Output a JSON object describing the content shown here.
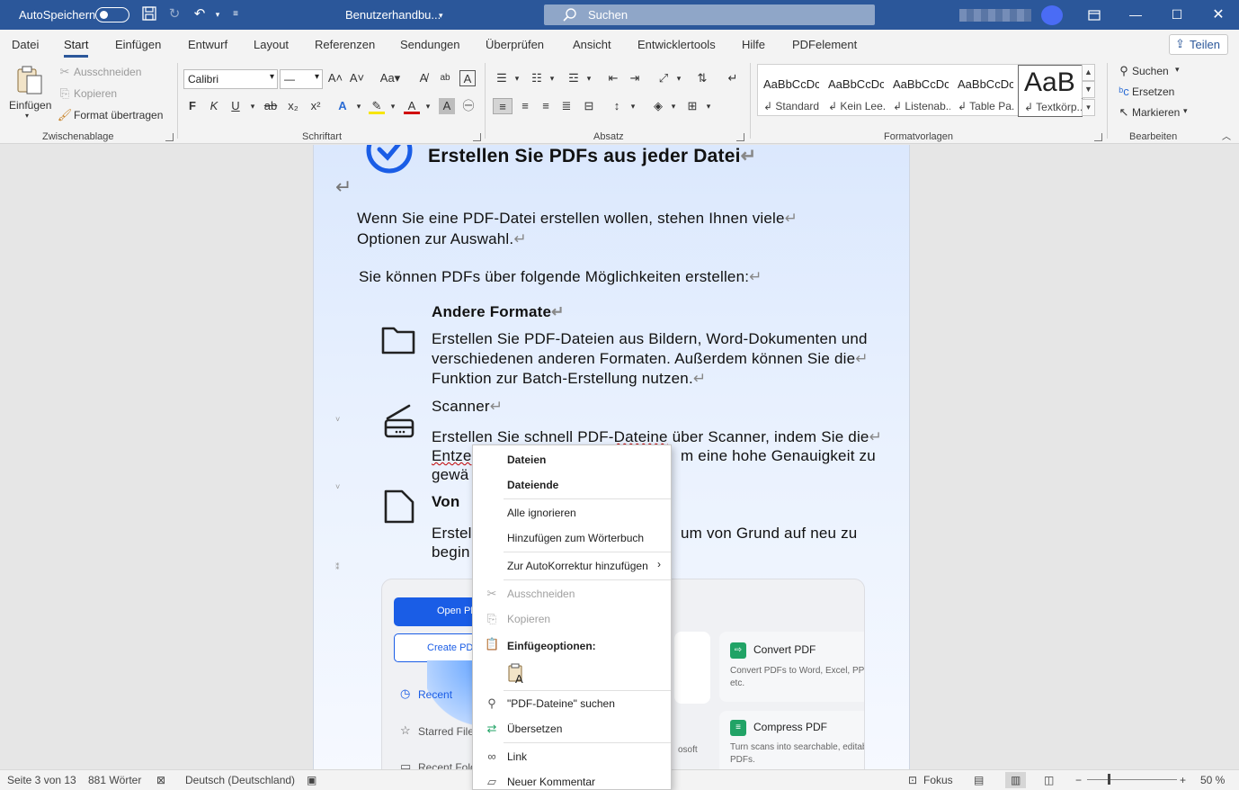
{
  "titlebar": {
    "autosave_label": "AutoSpeichern",
    "doc_title": "Benutzerhandbu...",
    "search_placeholder": "Suchen"
  },
  "menu": {
    "tabs": [
      "Datei",
      "Start",
      "Einfügen",
      "Entwurf",
      "Layout",
      "Referenzen",
      "Sendungen",
      "Überprüfen",
      "Ansicht",
      "Entwicklertools",
      "Hilfe",
      "PDFelement"
    ],
    "active_tab": "Start",
    "share_label": "Teilen"
  },
  "ribbon": {
    "clipboard": {
      "paste": "Einfügen",
      "cut": "Ausschneiden",
      "copy": "Kopieren",
      "format_painter": "Format übertragen",
      "group": "Zwischenablage"
    },
    "font": {
      "family": "Calibri",
      "group": "Schriftart"
    },
    "paragraph": {
      "group": "Absatz"
    },
    "styles": {
      "items": [
        {
          "preview": "AaBbCcDc",
          "name": "↲ Standard"
        },
        {
          "preview": "AaBbCcDc",
          "name": "↲ Kein Lee..."
        },
        {
          "preview": "AaBbCcDc",
          "name": "↲ Listenab..."
        },
        {
          "preview": "AaBbCcDc",
          "name": "↲ Table Pa..."
        },
        {
          "preview": "AaB",
          "name": "↲ Textkörp..."
        }
      ],
      "group": "Formatvorlagen"
    },
    "editing": {
      "find": "Suchen",
      "replace": "Ersetzen",
      "select": "Markieren",
      "group": "Bearbeiten"
    }
  },
  "document": {
    "heading": "Erstellen Sie PDFs aus jeder Datei",
    "intro_line1": "Wenn Sie eine PDF-Datei erstellen wollen, stehen Ihnen viele",
    "intro_line2": "Optionen zur Auswahl.",
    "options_line": "Sie können PDFs über folgende Möglichkeiten erstellen:",
    "sec1_title": "Andere Formate",
    "sec1_line1": "Erstellen Sie PDF-Dateien aus Bildern, Word-Dokumenten und",
    "sec1_line2": "verschiedenen anderen Formaten. Außerdem können Sie die",
    "sec1_line3": "Funktion zur Batch-Erstellung nutzen.",
    "sec2_title": "Scanner",
    "sec2_line1_a": "Erstellen Sie schnell PDF-",
    "sec2_line1_b": "Dateine",
    "sec2_line1_c": " über Scanner, indem Sie die",
    "sec2_line2_a": "Entze",
    "sec2_line2_b": "m eine hohe Genauigkeit zu",
    "sec2_line3": "gewä",
    "sec3_title": "Von ",
    "sec3_line1_a": "Erstel",
    "sec3_line1_b": "um von Grund auf neu zu",
    "sec3_line2": "begin",
    "app_shot": {
      "open_pdf": "Open PD",
      "create_pdf": "Create PDF",
      "recent": "Recent",
      "starred": "Starred Files",
      "recent_folders": "Recent Fold",
      "convert_title": "Convert PDF",
      "convert_desc_1": "Convert PDFs to Word, Excel, PPT,",
      "convert_desc_2": "etc.",
      "compress_title": "Compress PDF",
      "compress_desc_1": "Turn scans into searchable, editab",
      "compress_desc_2": "PDFs.",
      "microsoft_frag": "osoft"
    }
  },
  "context_menu": {
    "suggestion1": "Dateien",
    "suggestion2": "Dateiende",
    "ignore_all": "Alle ignorieren",
    "add_dict": "Hinzufügen zum Wörterbuch",
    "autocorrect": "Zur AutoKorrektur hinzufügen",
    "cut": "Ausschneiden",
    "copy": "Kopieren",
    "paste_options": "Einfügeoptionen:",
    "search": "\"PDF-Dateine\" suchen",
    "translate": "Übersetzen",
    "link": "Link",
    "new_comment": "Neuer Kommentar"
  },
  "statusbar": {
    "page": "Seite 3 von 13",
    "words": "881 Wörter",
    "language": "Deutsch (Deutschland)",
    "focus": "Fokus",
    "zoom": "50 %"
  }
}
